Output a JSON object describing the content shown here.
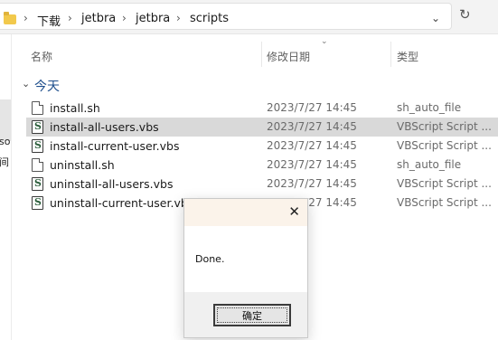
{
  "address_bar": {
    "breadcrumbs": [
      "下载",
      "jetbra",
      "jetbra",
      "scripts"
    ],
    "separator": "›"
  },
  "nav_fragments": [
    "so",
    "间"
  ],
  "columns": {
    "name": "名称",
    "date": "修改日期",
    "type": "类型"
  },
  "group": {
    "label": "今天"
  },
  "files": [
    {
      "name": "install.sh",
      "date": "2023/7/27 14:45",
      "type": "sh_auto_file",
      "icon": "document-icon",
      "selected": false
    },
    {
      "name": "install-all-users.vbs",
      "date": "2023/7/27 14:45",
      "type": "VBScript Script ...",
      "icon": "vbscript-icon",
      "selected": true
    },
    {
      "name": "install-current-user.vbs",
      "date": "2023/7/27 14:45",
      "type": "VBScript Script ...",
      "icon": "vbscript-icon",
      "selected": false
    },
    {
      "name": "uninstall.sh",
      "date": "2023/7/27 14:45",
      "type": "sh_auto_file",
      "icon": "document-icon",
      "selected": false
    },
    {
      "name": "uninstall-all-users.vbs",
      "date": "2023/7/27 14:45",
      "type": "VBScript Script ...",
      "icon": "vbscript-icon",
      "selected": false
    },
    {
      "name": "uninstall-current-user.vbs",
      "date": "2023/7/27 14:45",
      "type": "VBScript Script ...",
      "icon": "vbscript-icon",
      "selected": false
    }
  ],
  "dialog": {
    "message": "Done.",
    "ok_label": "确定",
    "close_glyph": "✕"
  },
  "colors": {
    "selected_row": "#d9d9d9",
    "dialog_title_bg": "#fbf3ea",
    "group_label": "#1e4e8c"
  }
}
